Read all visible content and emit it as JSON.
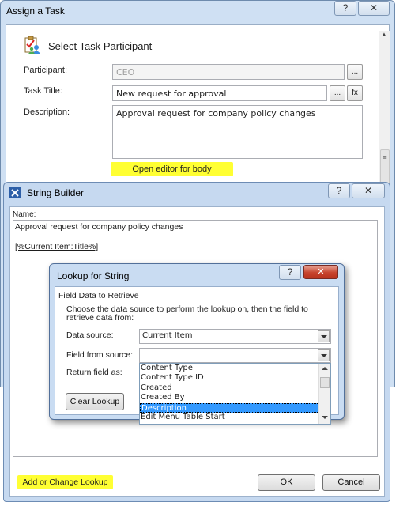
{
  "assign_task": {
    "title": "Assign a Task",
    "help_glyph": "?",
    "close_glyph": "✕",
    "section_title": "Select Task Participant",
    "participant_label": "Participant:",
    "participant_value": "CEO",
    "task_title_label": "Task Title:",
    "task_title_value": "New request for approval",
    "description_label": "Description:",
    "description_value": "Approval request for company policy changes",
    "ellipsis": "...",
    "fx": "fx",
    "open_editor_label": "Open editor for body",
    "scroll_up": "▲",
    "scroll_grip": "≡"
  },
  "string_builder": {
    "title": "String Builder",
    "help_glyph": "?",
    "close_glyph": "✕",
    "name_label": "Name:",
    "text_line": "Approval request for company policy changes",
    "lookup_token": "[%Current Item:Title%]",
    "add_lookup_label": "Add or Change Lookup",
    "ok_label": "OK",
    "cancel_label": "Cancel"
  },
  "lookup": {
    "title": "Lookup for String",
    "help_glyph": "?",
    "close_glyph": "✕",
    "group_label": "Field Data to Retrieve",
    "instructions": "Choose the data source to perform the lookup on, then the field to retrieve data from:",
    "data_source_label": "Data source:",
    "data_source_value": "Current Item",
    "field_from_source_label": "Field from source:",
    "field_from_source_value": "",
    "return_field_label": "Return field as:",
    "clear_lookup_label": "Clear Lookup",
    "field_options": [
      "Content Type",
      "Content Type ID",
      "Created",
      "Created By",
      "Description",
      "Edit Menu Table Start"
    ],
    "selected_field": "Description"
  },
  "colors": {
    "highlight": "#ffff33",
    "selection": "#3399ff",
    "close_red": "#c7432d"
  }
}
